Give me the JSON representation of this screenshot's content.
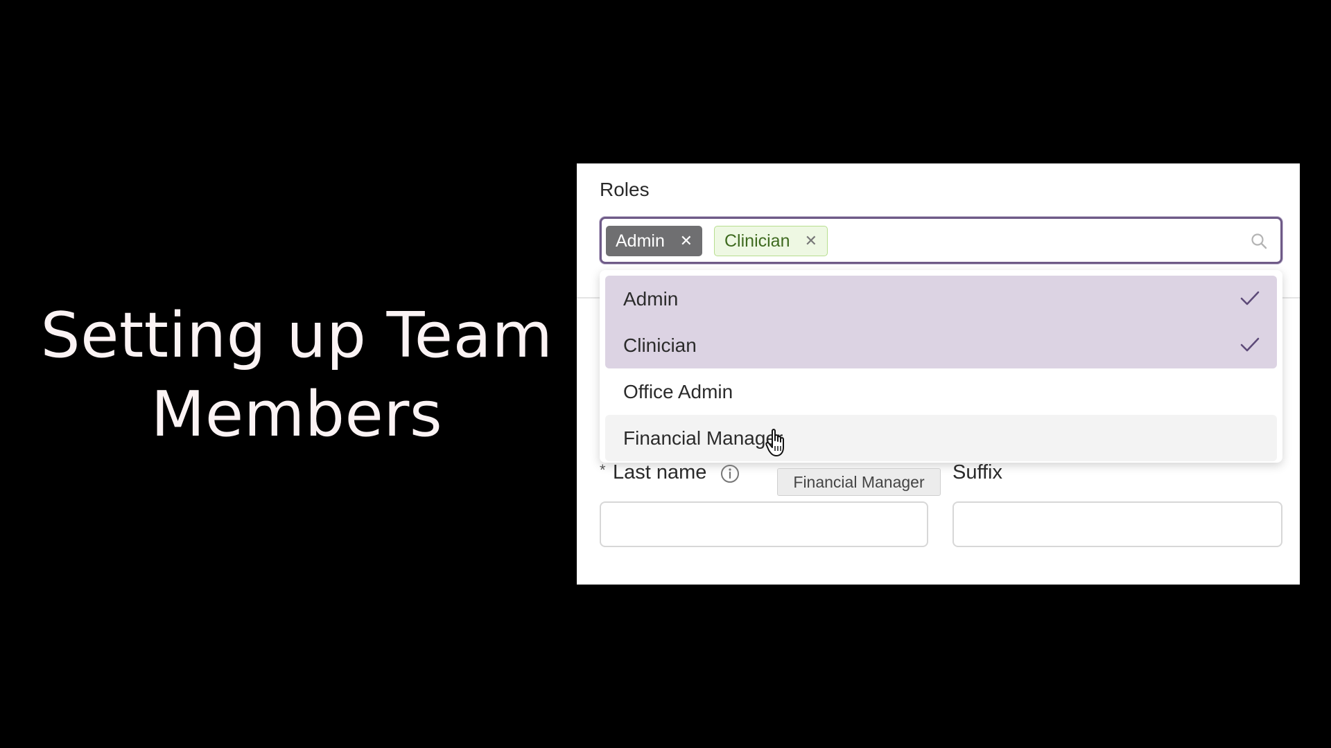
{
  "slide": {
    "title_line1": "Setting up Team",
    "title_line2": "Members"
  },
  "roles": {
    "label": "Roles",
    "selected_tags": [
      {
        "label": "Admin",
        "close": "✕"
      },
      {
        "label": "Clinician",
        "close": "✕"
      }
    ],
    "search_icon": "search-icon",
    "options": [
      {
        "label": "Admin",
        "selected": true
      },
      {
        "label": "Clinician",
        "selected": true
      },
      {
        "label": "Office Admin",
        "selected": false
      },
      {
        "label": "Financial Manager",
        "selected": false,
        "hovered": true
      }
    ],
    "tooltip": "Financial Manager"
  },
  "form": {
    "required_marker": "*",
    "last_name_label": "Last name",
    "suffix_label": "Suffix",
    "last_name_value": "",
    "suffix_value": ""
  },
  "colors": {
    "background": "#000000",
    "title_text": "#fbf3f4",
    "select_border": "#6e5a87",
    "selected_option": "#dcd3e3",
    "admin_tag": "#6f6f71",
    "clinician_tag_bg": "#eef8e3",
    "clinician_tag_text": "#3f6b20"
  }
}
